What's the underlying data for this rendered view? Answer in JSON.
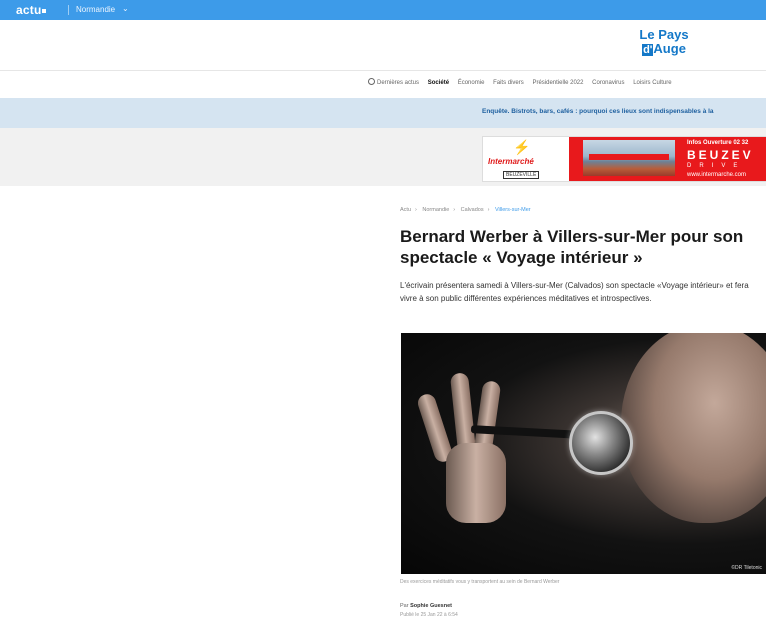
{
  "topbar": {
    "logo": "actu",
    "region": "Normandie",
    "chevron": "⌄"
  },
  "brand": {
    "line1": "Le Pays",
    "line2_prefix": "d'",
    "line2": "Auge"
  },
  "nav": {
    "items": [
      {
        "label": "Dernières actus",
        "active": false
      },
      {
        "label": "Société",
        "active": true
      },
      {
        "label": "Économie",
        "active": false
      },
      {
        "label": "Faits divers",
        "active": false
      },
      {
        "label": "Présidentielle 2022",
        "active": false
      },
      {
        "label": "Coronavirus",
        "active": false
      },
      {
        "label": "Loisirs Culture",
        "active": false
      }
    ]
  },
  "breaking": {
    "text": "Enquête. Bistrots, bars, cafés : pourquoi ces lieux sont indispensables à la"
  },
  "ad": {
    "brand": "Intermarché",
    "town_small": "BEUZEVILLE",
    "hours": "Infos Ouverture 02 32",
    "town": "BEUZEV",
    "drive": "DRIVE",
    "web": "www.intermarche.com"
  },
  "breadcrumb": [
    "Actu",
    "Normandie",
    "Calvados",
    "Villers-sur-Mer"
  ],
  "article": {
    "title": "Bernard Werber à Villers-sur-Mer pour son spectacle « Voyage intérieur »",
    "lead": "L'écrivain présentera samedi à Villers-sur-Mer (Calvados) son spectacle «Voyage intérieur» et fera vivre à son public différentes expériences méditatives et introspectives.",
    "photo_credit": "©DR Tiletonic",
    "caption": "Des exercices méditatifs vous y transportent au sein de Bernard Werber",
    "byline_prefix": "Par",
    "author": "Sophie Guesnet",
    "published": "Publié le 25 Jan 22 à 6:54"
  },
  "colors": {
    "topbar": "#3d9be9",
    "breaking_bg": "#d5e4f1",
    "ad_red": "#e8191c"
  }
}
